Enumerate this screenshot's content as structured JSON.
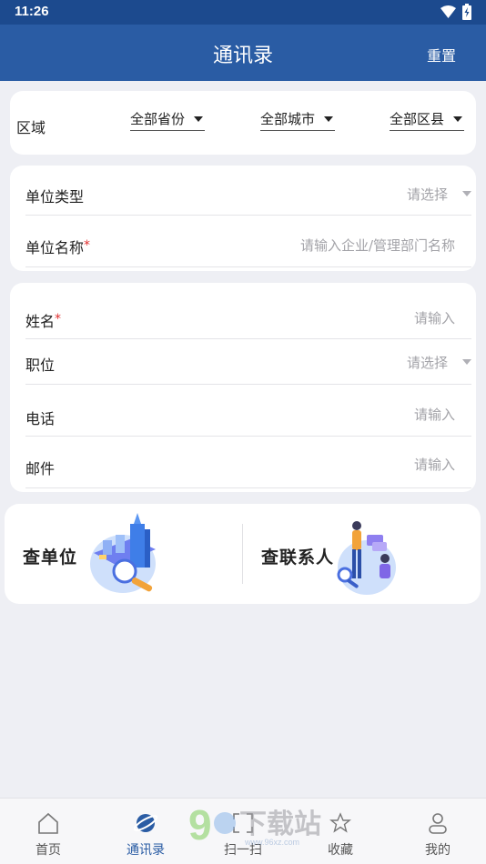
{
  "status_bar": {
    "time": "11:26",
    "icons": [
      "wifi-icon",
      "battery-charging-icon"
    ]
  },
  "app_bar": {
    "title": "通讯录",
    "reset_label": "重置"
  },
  "region": {
    "label": "区域",
    "province": "全部省份",
    "city": "全部城市",
    "district": "全部区县"
  },
  "unit": {
    "type_label": "单位类型",
    "type_placeholder": "请选择",
    "name_label": "单位名称",
    "name_required": "*",
    "name_placeholder": "请输入企业/管理部门名称"
  },
  "person": {
    "name_label": "姓名",
    "name_required": "*",
    "name_placeholder": "请输入",
    "position_label": "职位",
    "position_placeholder": "请选择",
    "phone_label": "电话",
    "phone_placeholder": "请输入",
    "email_label": "邮件",
    "email_placeholder": "请输入"
  },
  "actions": {
    "search_unit": "查单位",
    "search_contact": "查联系人"
  },
  "tabs": [
    {
      "label": "首页",
      "icon": "home-icon"
    },
    {
      "label": "通讯录",
      "icon": "planet-icon",
      "active": true
    },
    {
      "label": "扫一扫",
      "icon": "scan-icon"
    },
    {
      "label": "收藏",
      "icon": "star-icon"
    },
    {
      "label": "我的",
      "icon": "user-icon"
    }
  ],
  "watermark": {
    "text": "下载站",
    "url": "www.96xz.com"
  },
  "colors": {
    "primary": "#2a5ca4",
    "status_bar": "#1c4a8e",
    "background": "#eeeff4",
    "required": "#e03030"
  }
}
